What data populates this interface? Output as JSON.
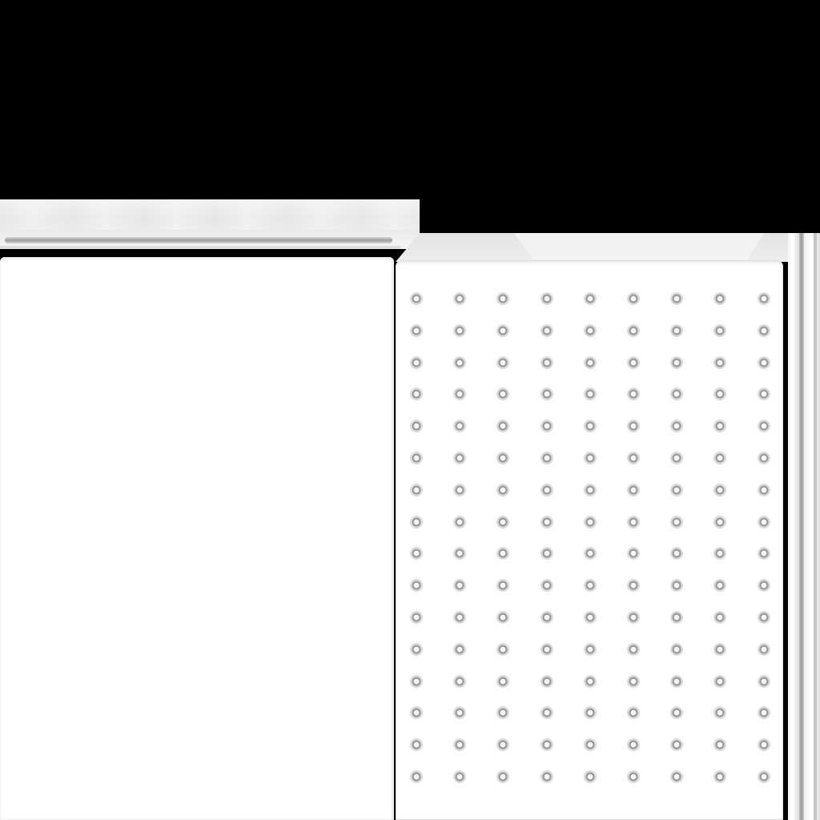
{
  "scene": {
    "background_color": "#000000",
    "panel_color": "#ffffff",
    "rail_color": "#e8e8e8"
  },
  "perforated_panel": {
    "columns": 9,
    "rows": 16,
    "hole_icon": "hole-icon"
  }
}
